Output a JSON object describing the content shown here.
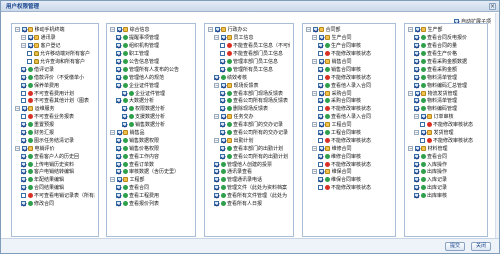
{
  "dialog": {
    "title": "用户权限管理",
    "close_label": "×"
  },
  "options": {
    "auto_expand_label": "自动扩展子项",
    "auto_expand_checked": true
  },
  "footer": {
    "ok_label": "提交",
    "close_label": "关闭"
  },
  "columns": [
    {
      "items": [
        {
          "depth": 0,
          "icon": "folder",
          "label": "移动手机终端",
          "checked": true
        },
        {
          "depth": 1,
          "icon": "folder",
          "label": "通讯录",
          "checked": true
        },
        {
          "depth": 1,
          "icon": "folder",
          "label": "客户登记",
          "checked": true
        },
        {
          "depth": 2,
          "icon": "lock",
          "label": "允许移动端对所有客户",
          "checked": false
        },
        {
          "depth": 2,
          "icon": "lock",
          "label": "允许查询和所有客户",
          "checked": false
        },
        {
          "depth": 1,
          "icon": "grn",
          "label": "借评记录",
          "checked": true
        },
        {
          "depth": 1,
          "icon": "grn",
          "label": "借款评价（不受缴单小",
          "checked": true
        },
        {
          "depth": 1,
          "icon": "grn",
          "label": "保养单费用",
          "checked": true
        },
        {
          "depth": 1,
          "icon": "red",
          "label": "不可查看费用计划",
          "checked": false
        },
        {
          "depth": 1,
          "icon": "red",
          "label": "不可查看其他计划（图表",
          "checked": false
        },
        {
          "depth": 0,
          "icon": "folder",
          "label": "运维服务",
          "checked": true
        },
        {
          "depth": 1,
          "icon": "red",
          "label": "不可查看业务报表",
          "checked": false
        },
        {
          "depth": 1,
          "icon": "grn",
          "label": "重置预报",
          "checked": true
        },
        {
          "depth": 1,
          "icon": "grn",
          "label": "财务汇报",
          "checked": true
        },
        {
          "depth": 1,
          "icon": "grn",
          "label": "图示任务结清记录",
          "checked": true
        },
        {
          "depth": 0,
          "icon": "folder",
          "label": "电销评价",
          "checked": true
        },
        {
          "depth": 1,
          "icon": "grn",
          "label": "查看客户人的历史回",
          "checked": true
        },
        {
          "depth": 1,
          "icon": "grn",
          "label": "上传电销历史资料",
          "checked": true
        },
        {
          "depth": 1,
          "icon": "grn",
          "label": "客户电销结转编辑",
          "checked": true
        },
        {
          "depth": 1,
          "icon": "grn",
          "label": "年配结果编辑",
          "checked": true
        },
        {
          "depth": 1,
          "icon": "grn",
          "label": "合同结果编辑",
          "checked": true
        },
        {
          "depth": 1,
          "icon": "red",
          "label": "不可查看电销记录表（所有系",
          "checked": false
        },
        {
          "depth": 1,
          "icon": "grn",
          "label": "修改合同",
          "checked": true
        }
      ]
    },
    {
      "items": [
        {
          "depth": 0,
          "icon": "folder",
          "label": "综合信息",
          "checked": true
        },
        {
          "depth": 1,
          "icon": "grn",
          "label": "提醒事项管理",
          "checked": true
        },
        {
          "depth": 1,
          "icon": "grn",
          "label": "组织机构管理",
          "checked": true
        },
        {
          "depth": 1,
          "icon": "grn",
          "label": "职工管理",
          "checked": true
        },
        {
          "depth": 1,
          "icon": "grn",
          "label": "公告信息管理",
          "checked": true
        },
        {
          "depth": 1,
          "icon": "grn",
          "label": "管理所有人发布的公告",
          "checked": true
        },
        {
          "depth": 1,
          "icon": "grn",
          "label": "管理他人的规范",
          "checked": true
        },
        {
          "depth": 1,
          "icon": "grn",
          "label": "企业证件管理",
          "checked": true
        },
        {
          "depth": 2,
          "icon": "grn",
          "label": "企业证件管理",
          "checked": true
        },
        {
          "depth": 1,
          "icon": "grn",
          "label": "大数据分析",
          "checked": true
        },
        {
          "depth": 2,
          "icon": "grn",
          "label": "权限数据分析",
          "checked": true
        },
        {
          "depth": 2,
          "icon": "grn",
          "label": "支援数据分析",
          "checked": true
        },
        {
          "depth": 2,
          "icon": "grn",
          "label": "销售数据分析",
          "checked": true
        },
        {
          "depth": 0,
          "icon": "folder",
          "label": "销售品",
          "checked": true
        },
        {
          "depth": 1,
          "icon": "grn",
          "label": "销售数据权限",
          "checked": true
        },
        {
          "depth": 1,
          "icon": "grn",
          "label": "销售价格权限",
          "checked": true
        },
        {
          "depth": 1,
          "icon": "grn",
          "label": "查看工作内容",
          "checked": true
        },
        {
          "depth": 1,
          "icon": "grn",
          "label": "查看订单数",
          "checked": true
        },
        {
          "depth": 1,
          "icon": "grn",
          "label": "审核数据（含历史里）",
          "checked": true
        },
        {
          "depth": 0,
          "icon": "folder",
          "label": "工程部",
          "checked": true
        },
        {
          "depth": 1,
          "icon": "grn",
          "label": "查看合同",
          "checked": true
        },
        {
          "depth": 1,
          "icon": "grn",
          "label": "查看工程费用",
          "checked": true
        },
        {
          "depth": 1,
          "icon": "grn",
          "label": "查看报价列表",
          "checked": true
        }
      ]
    },
    {
      "items": [
        {
          "depth": 0,
          "icon": "folder",
          "label": "行政办公",
          "checked": true
        },
        {
          "depth": 1,
          "icon": "folder",
          "label": "员工信息",
          "checked": true
        },
        {
          "depth": 2,
          "icon": "red",
          "label": "不能查看员工信息（不可修",
          "checked": false
        },
        {
          "depth": 2,
          "icon": "red",
          "label": "不能查看部门员工信息",
          "checked": false
        },
        {
          "depth": 2,
          "icon": "grn",
          "label": "管理本部门员工信息",
          "checked": true
        },
        {
          "depth": 2,
          "icon": "grn",
          "label": "管理所有员工信息",
          "checked": true
        },
        {
          "depth": 1,
          "icon": "grn",
          "label": "绩效考核",
          "checked": true
        },
        {
          "depth": 1,
          "icon": "folder",
          "label": "现场反馈表",
          "checked": true
        },
        {
          "depth": 2,
          "icon": "grn",
          "label": "查看本部门现场反馈表",
          "checked": true
        },
        {
          "depth": 2,
          "icon": "grn",
          "label": "查看公司所有现场反馈表",
          "checked": true
        },
        {
          "depth": 2,
          "icon": "grn",
          "label": "删除现场反馈表",
          "checked": true
        },
        {
          "depth": 1,
          "icon": "folder",
          "label": "任务交办",
          "checked": true
        },
        {
          "depth": 2,
          "icon": "grn",
          "label": "查看本部门的交办记录",
          "checked": true
        },
        {
          "depth": 2,
          "icon": "grn",
          "label": "查看公司所有的交办记录",
          "checked": true
        },
        {
          "depth": 1,
          "icon": "folder",
          "label": "出勤计划",
          "checked": true
        },
        {
          "depth": 2,
          "icon": "grn",
          "label": "查看本部门的出勤计划",
          "checked": true
        },
        {
          "depth": 2,
          "icon": "grn",
          "label": "查看公司所有的出勤计划",
          "checked": true
        },
        {
          "depth": 1,
          "icon": "grn",
          "label": "管理他人创建的投票",
          "checked": true
        },
        {
          "depth": 1,
          "icon": "grn",
          "label": "通讯录查看",
          "checked": true
        },
        {
          "depth": 1,
          "icon": "grn",
          "label": "管理通讯录电话",
          "checked": true
        },
        {
          "depth": 1,
          "icon": "grn",
          "label": "管理文件（此处为资料档案",
          "checked": true
        },
        {
          "depth": 1,
          "icon": "grn",
          "label": "查看所有文件管理（此处为",
          "checked": true
        },
        {
          "depth": 1,
          "icon": "grn",
          "label": "查看所有人日报",
          "checked": true
        }
      ]
    },
    {
      "items": [
        {
          "depth": 0,
          "icon": "folder",
          "label": "合同部",
          "checked": true
        },
        {
          "depth": 1,
          "icon": "folder",
          "label": "生产合同",
          "checked": true
        },
        {
          "depth": 2,
          "icon": "grn",
          "label": "生产合同审核",
          "checked": true
        },
        {
          "depth": 2,
          "icon": "red",
          "label": "不能修改审核状态",
          "checked": false
        },
        {
          "depth": 1,
          "icon": "folder",
          "label": "销售合同",
          "checked": true
        },
        {
          "depth": 2,
          "icon": "grn",
          "label": "销售合同审核",
          "checked": true
        },
        {
          "depth": 2,
          "icon": "red",
          "label": "不能修改审核状态",
          "checked": false
        },
        {
          "depth": 2,
          "icon": "grn",
          "label": "查看他人录入合同",
          "checked": true
        },
        {
          "depth": 1,
          "icon": "folder",
          "label": "采购合同",
          "checked": true
        },
        {
          "depth": 2,
          "icon": "grn",
          "label": "采购合同审核",
          "checked": true
        },
        {
          "depth": 2,
          "icon": "red",
          "label": "不能修改审核状态",
          "checked": false
        },
        {
          "depth": 2,
          "icon": "grn",
          "label": "查看他人录入合同",
          "checked": true
        },
        {
          "depth": 1,
          "icon": "folder",
          "label": "工程合同",
          "checked": true
        },
        {
          "depth": 2,
          "icon": "grn",
          "label": "工程合同审核",
          "checked": true
        },
        {
          "depth": 2,
          "icon": "red",
          "label": "不能修改审核状态",
          "checked": false
        },
        {
          "depth": 1,
          "icon": "folder",
          "label": "维修合同",
          "checked": true
        },
        {
          "depth": 2,
          "icon": "grn",
          "label": "维修合同审核",
          "checked": true
        },
        {
          "depth": 2,
          "icon": "red",
          "label": "不能修改审核状态",
          "checked": false
        },
        {
          "depth": 1,
          "icon": "folder",
          "label": "维保合同",
          "checked": true
        },
        {
          "depth": 2,
          "icon": "grn",
          "label": "维保合同审核",
          "checked": true
        },
        {
          "depth": 2,
          "icon": "red",
          "label": "不能修改审核状态",
          "checked": false
        }
      ]
    },
    {
      "items": [
        {
          "depth": 0,
          "icon": "folder",
          "label": "生产部",
          "checked": true
        },
        {
          "depth": 1,
          "icon": "grn",
          "label": "查看合同反电报价",
          "checked": true
        },
        {
          "depth": 1,
          "icon": "grn",
          "label": "查看合同的量",
          "checked": true
        },
        {
          "depth": 1,
          "icon": "grn",
          "label": "查看生产价格",
          "checked": true
        },
        {
          "depth": 1,
          "icon": "grn",
          "label": "查看采购金额数据",
          "checked": true
        },
        {
          "depth": 1,
          "icon": "grn",
          "label": "查看采购金额",
          "checked": true
        },
        {
          "depth": 1,
          "icon": "grn",
          "label": "物料清单管理",
          "checked": true
        },
        {
          "depth": 1,
          "icon": "grn",
          "label": "物料编码汇总管理",
          "checked": true
        },
        {
          "depth": 0,
          "icon": "folder",
          "label": "物流发货管理",
          "checked": true
        },
        {
          "depth": 1,
          "icon": "grn",
          "label": "物料清单管理",
          "checked": true
        },
        {
          "depth": 1,
          "icon": "grn",
          "label": "物料编码管理",
          "checked": true
        },
        {
          "depth": 1,
          "icon": "folder",
          "label": "订单审核",
          "checked": true
        },
        {
          "depth": 2,
          "icon": "red",
          "label": "不能修改审核状态",
          "checked": false
        },
        {
          "depth": 1,
          "icon": "folder",
          "label": "发货管理",
          "checked": true
        },
        {
          "depth": 2,
          "icon": "red",
          "label": "不能修改审核状态",
          "checked": false
        },
        {
          "depth": 0,
          "icon": "folder",
          "label": "材料管理",
          "checked": true
        },
        {
          "depth": 1,
          "icon": "grn",
          "label": "查看合同",
          "checked": true
        },
        {
          "depth": 1,
          "icon": "grn",
          "label": "入库操作",
          "checked": true
        },
        {
          "depth": 1,
          "icon": "grn",
          "label": "出库操作",
          "checked": true
        },
        {
          "depth": 1,
          "icon": "grn",
          "label": "入库记录",
          "checked": true
        },
        {
          "depth": 1,
          "icon": "grn",
          "label": "出库记录",
          "checked": true
        },
        {
          "depth": 1,
          "icon": "grn",
          "label": "出库审核",
          "checked": true
        }
      ]
    }
  ]
}
